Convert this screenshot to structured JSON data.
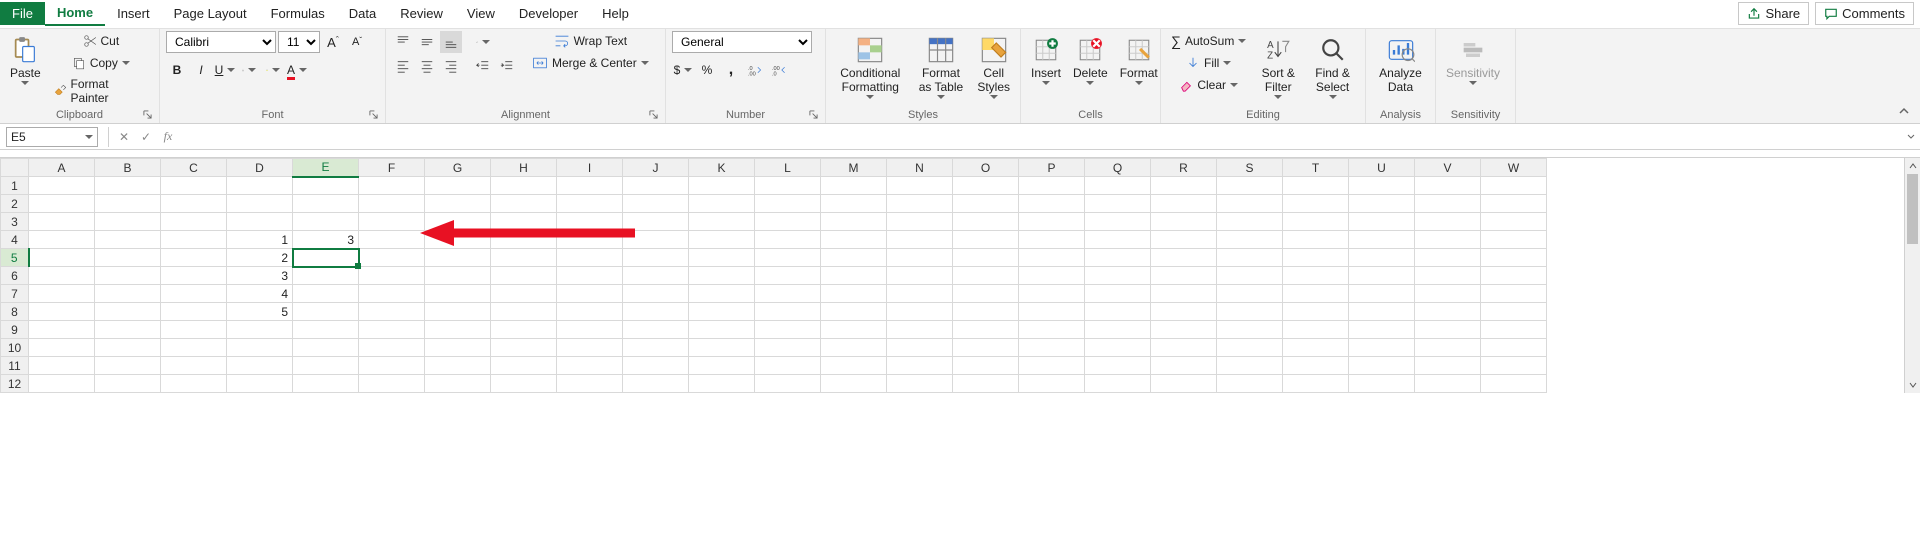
{
  "tabs": {
    "file": "File",
    "home": "Home",
    "insert": "Insert",
    "pageLayout": "Page Layout",
    "formulas": "Formulas",
    "data": "Data",
    "review": "Review",
    "view": "View",
    "developer": "Developer",
    "help": "Help",
    "active": "home"
  },
  "topRight": {
    "share": "Share",
    "comments": "Comments"
  },
  "ribbon": {
    "clipboard": {
      "paste": "Paste",
      "cut": "Cut",
      "copy": "Copy",
      "formatPainter": "Format Painter",
      "label": "Clipboard"
    },
    "font": {
      "name": "Calibri",
      "size": "11",
      "label": "Font"
    },
    "alignment": {
      "wrap": "Wrap Text",
      "merge": "Merge & Center",
      "label": "Alignment"
    },
    "number": {
      "format": "General",
      "label": "Number"
    },
    "styles": {
      "conditional": "Conditional Formatting",
      "formatTable": "Format as Table",
      "cellStyles": "Cell Styles",
      "label": "Styles"
    },
    "cells": {
      "insert": "Insert",
      "delete": "Delete",
      "format": "Format",
      "label": "Cells"
    },
    "editing": {
      "autosum": "AutoSum",
      "fill": "Fill",
      "clear": "Clear",
      "sortFilter": "Sort & Filter",
      "findSelect": "Find & Select",
      "label": "Editing"
    },
    "analysis": {
      "analyze": "Analyze Data",
      "label": "Analysis"
    },
    "sensitivity": {
      "btn": "Sensitivity",
      "label": "Sensitivity"
    }
  },
  "formulaBar": {
    "nameBox": "E5",
    "formula": ""
  },
  "gridMeta": {
    "cols": [
      "A",
      "B",
      "C",
      "D",
      "E",
      "F",
      "G",
      "H",
      "I",
      "J",
      "K",
      "L",
      "M",
      "N",
      "O",
      "P",
      "Q",
      "R",
      "S",
      "T",
      "U",
      "V",
      "W"
    ],
    "rows": 12,
    "activeCell": "E5"
  },
  "cells": {
    "D4": "1",
    "D5": "2",
    "D6": "3",
    "D7": "4",
    "D8": "5",
    "E4": "3"
  }
}
